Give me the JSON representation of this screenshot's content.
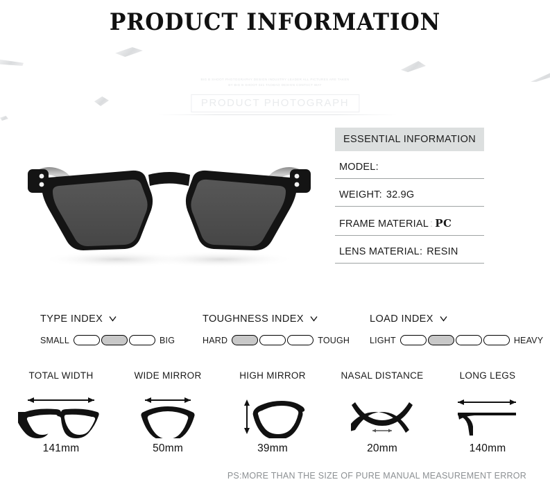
{
  "page": {
    "title": "PRODUCT INFORMATION",
    "footer_note": "PS:MORE THAN THE SIZE OF PURE MANUAL MEASUREMENT ERROR"
  },
  "photo": {
    "microtext": "BIG B SHOOT PHOTOGRAPHY DESIGN INDUSTRY LEADER ALL PICTURES ARE TAKEN\nBY BIG B SHOOT 021 TAOBAO DESIGN CONTACT WAY",
    "badge": "PRODUCT PHOTOGRAPH",
    "subject": "black-square-frame-sunglasses"
  },
  "essential_info": {
    "header": "ESSENTIAL INFORMATION",
    "rows": [
      {
        "label": "MODEL:",
        "value": ""
      },
      {
        "label": "WEIGHT:",
        "value": "32.9G"
      },
      {
        "label": "FRAME MATERIAL",
        "colon": ":",
        "value": "PC"
      },
      {
        "label": "LENS MATERIAL:",
        "value": "RESIN"
      }
    ],
    "header_bg": "#dcdfdf"
  },
  "indexes": [
    {
      "title": "TYPE INDEX",
      "left_label": "SMALL",
      "right_label": "BIG",
      "steps": 3,
      "active": 2
    },
    {
      "title": "TOUGHNESS INDEX",
      "left_label": "HARD",
      "right_label": "TOUGH",
      "steps": 3,
      "active": 1
    },
    {
      "title": "LOAD INDEX",
      "left_label": "LIGHT",
      "right_label": "HEAVY",
      "steps": 4,
      "active": 2
    }
  ],
  "measurements": [
    {
      "label": "TOTAL WIDTH",
      "value": "141mm",
      "icon": "full-frame-width-icon"
    },
    {
      "label": "WIDE MIRROR",
      "value": "50mm",
      "icon": "lens-width-icon"
    },
    {
      "label": "HIGH MIRROR",
      "value": "39mm",
      "icon": "lens-height-icon"
    },
    {
      "label": "NASAL DISTANCE",
      "value": "20mm",
      "icon": "bridge-width-icon"
    },
    {
      "label": "LONG LEGS",
      "value": "140mm",
      "icon": "temple-length-icon"
    }
  ],
  "colors": {
    "pill_fill": "#c8c8c8",
    "pill_stroke": "#000000",
    "panel_header": "#dcdfdf",
    "divider": "#9ea3a3",
    "footer_text": "#8c9093"
  }
}
